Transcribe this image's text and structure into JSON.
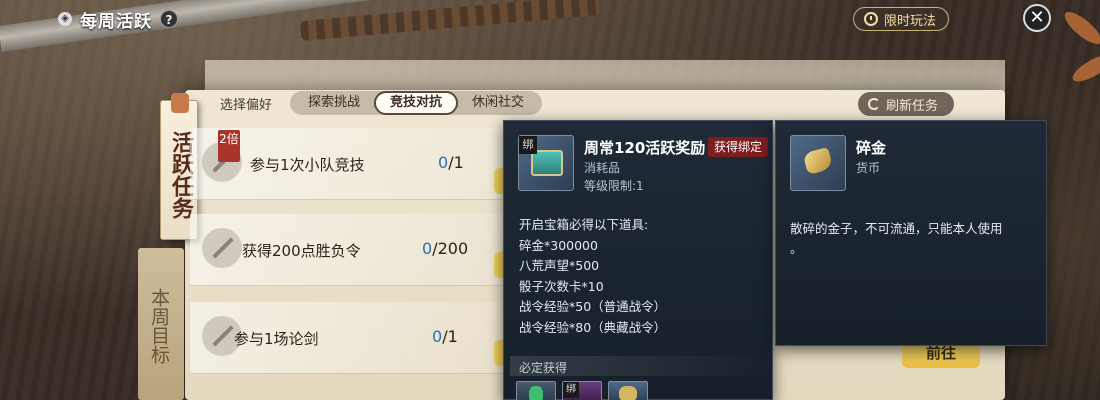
{
  "header": {
    "title": "每周活跃",
    "help_label": "?"
  },
  "limited_button": {
    "label": "限时玩法"
  },
  "close_button": {
    "label": "✕"
  },
  "side_tabs": [
    {
      "label": "活跃任务",
      "active": true
    },
    {
      "label": "本周目标",
      "active": false
    }
  ],
  "preference": {
    "label": "选择偏好",
    "options": [
      "探索挑战",
      "竞技对抗",
      "休闲社交"
    ],
    "selected": "竞技对抗"
  },
  "refresh_button": {
    "label": "刷新任务"
  },
  "tasks": [
    {
      "name": "参与1次小队竞技",
      "current": "0",
      "total": "/1",
      "multiplier": "2倍"
    },
    {
      "name": "获得200点胜负令",
      "current": "0",
      "total": "/200"
    },
    {
      "name": "参与1场论剑",
      "current": "0",
      "total": "/1"
    }
  ],
  "go_button": {
    "label": "前往"
  },
  "reward_tooltip": {
    "bind_tag": "绑",
    "name": "周常120活跃奖励",
    "bound_badge": "获得绑定",
    "type": "消耗品",
    "level_limit": "等级限制:1",
    "lines": [
      "开启宝箱必得以下道具:",
      "碎金*300000",
      "八荒声望*500",
      "骰子次数卡*10",
      "战令经验*50（普通战令）",
      "战令经验*80（典藏战令）"
    ],
    "section_label": "必定获得",
    "mini_bind_tag": "绑"
  },
  "gold_tooltip": {
    "name": "碎金",
    "type": "货币",
    "description": "散碎的金子，不可流通，只能本人使用",
    "description_tail": "。"
  }
}
